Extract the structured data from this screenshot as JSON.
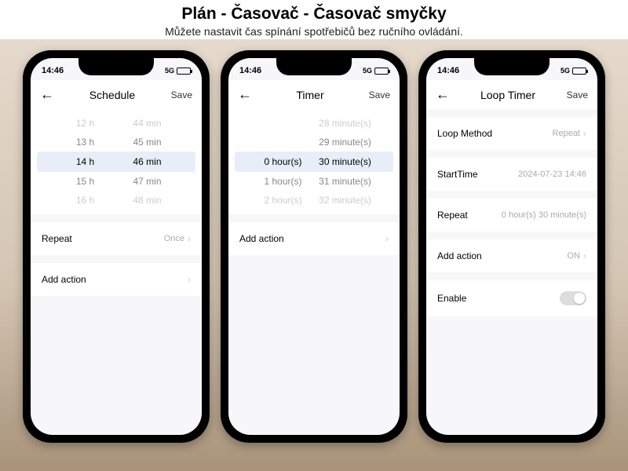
{
  "header": {
    "title": "Plán - Časovač - Časovač smyčky",
    "subtitle": "Můžete nastavit čas spínání spotřebičů bez ručního ovládání."
  },
  "status": {
    "time": "14:46",
    "network": "5G"
  },
  "nav": {
    "save": "Save"
  },
  "phone1": {
    "title": "Schedule",
    "picker": [
      {
        "h": "12 h",
        "m": "44 min",
        "cls": "faded"
      },
      {
        "h": "13 h",
        "m": "45 min",
        "cls": "dim"
      },
      {
        "h": "14 h",
        "m": "46 min",
        "cls": "selected"
      },
      {
        "h": "15 h",
        "m": "47 min",
        "cls": "dim"
      },
      {
        "h": "16 h",
        "m": "48 min",
        "cls": "faded"
      }
    ],
    "repeat_label": "Repeat",
    "repeat_value": "Once",
    "add_action": "Add action"
  },
  "phone2": {
    "title": "Timer",
    "picker": [
      {
        "h": "",
        "m": "28 minute(s)",
        "cls": "faded"
      },
      {
        "h": "",
        "m": "29 minute(s)",
        "cls": "dim"
      },
      {
        "h": "0 hour(s)",
        "m": "30 minute(s)",
        "cls": "selected"
      },
      {
        "h": "1 hour(s)",
        "m": "31 minute(s)",
        "cls": "dim"
      },
      {
        "h": "2 hour(s)",
        "m": "32 minute(s)",
        "cls": "faded"
      }
    ],
    "add_action": "Add action"
  },
  "phone3": {
    "title": "Loop Timer",
    "rows": {
      "loop_method": {
        "label": "Loop Method",
        "value": "Repeat"
      },
      "start_time": {
        "label": "StartTime",
        "value": "2024-07-23 14:46"
      },
      "repeat": {
        "label": "Repeat",
        "value": "0 hour(s) 30 minute(s)"
      },
      "add_action": {
        "label": "Add action",
        "value": "ON"
      },
      "enable": {
        "label": "Enable"
      }
    }
  }
}
